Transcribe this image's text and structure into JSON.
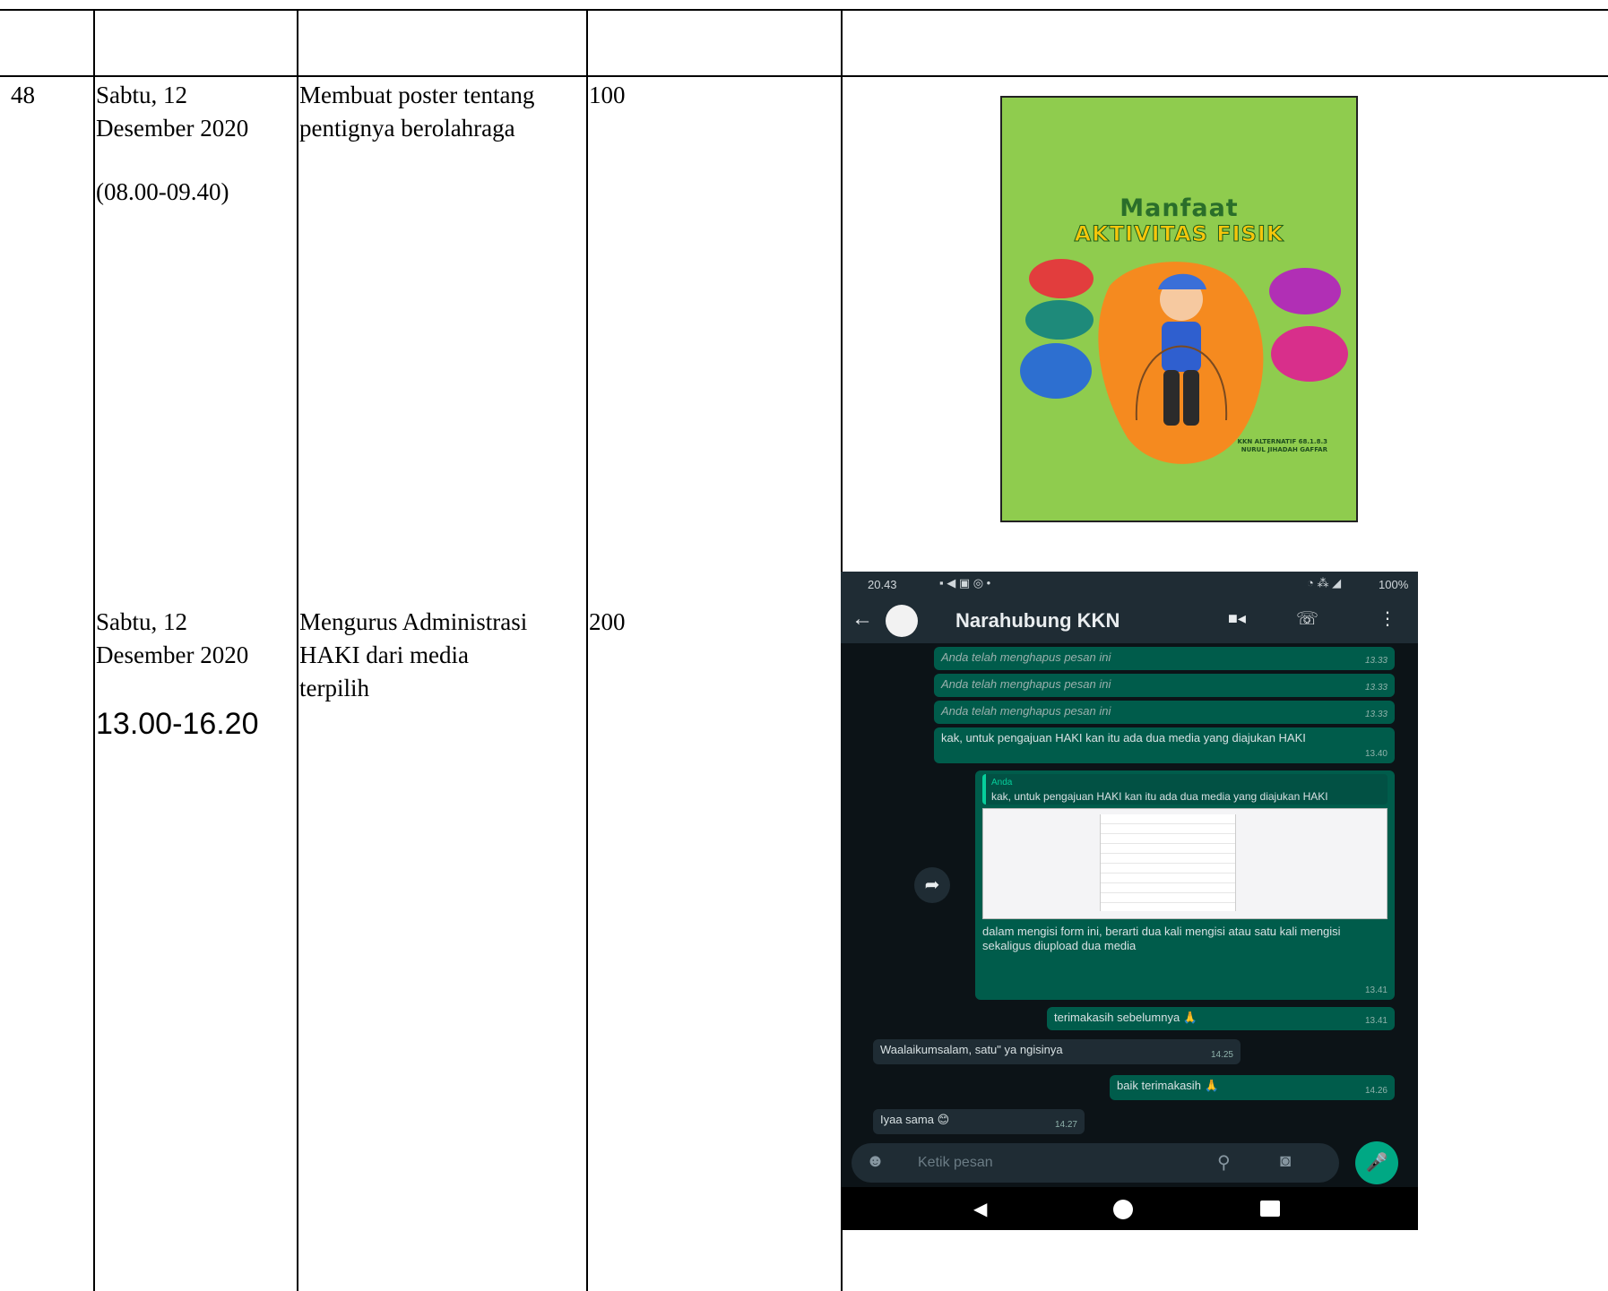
{
  "table": {
    "row_no": "48",
    "entries": [
      {
        "date_line1": "Sabtu, 12",
        "date_line2": "Desember 2020",
        "time": "(08.00-09.40)",
        "activity_line1": "Membuat poster tentang",
        "activity_line2": "pentignya berolahraga",
        "value": "100"
      },
      {
        "date_line1": "Sabtu, 12",
        "date_line2": "Desember 2020",
        "time": "13.00-16.20",
        "activity_line1": "Mengurus Administrasi",
        "activity_line2": "HAKI dari media",
        "activity_line3": "terpilih",
        "value": "200"
      }
    ]
  },
  "poster": {
    "title_line1": "Manfaat",
    "title_line2": "AKTIVITAS FISIK",
    "credit_line1": "KKN ALTERNATIF 68.1.8.3",
    "credit_line2": "NURUL JIHADAH GAFFAR",
    "background": "#8fcc4e"
  },
  "chat": {
    "status_time": "20.43",
    "battery": "100%",
    "contact_name": "Narahubung KKN",
    "messages": [
      {
        "text": "Anda telah menghapus pesan ini",
        "time": "13.33"
      },
      {
        "text": "Anda telah menghapus pesan ini",
        "time": "13.33"
      },
      {
        "text": "Anda telah menghapus pesan ini",
        "time": "13.33"
      },
      {
        "text": "kak, untuk pengajuan HAKI kan itu ada dua media yang diajukan HAKI",
        "time": "13.40"
      },
      {
        "quote_author": "Anda",
        "quote_text": "kak, untuk pengajuan HAKI kan itu ada dua media yang diajukan HAKI",
        "text": "dalam mengisi form ini, berarti dua kali mengisi atau satu kali mengisi sekaligus diupload dua media",
        "time": "13.41"
      },
      {
        "text": "terimakasih sebelumnya 🙏",
        "time": "13.41"
      },
      {
        "text": "Waalaikumsalam, satu\" ya ngisinya",
        "time": "14.25"
      },
      {
        "text": "baik terimakasih 🙏",
        "time": "14.26"
      },
      {
        "text": "Iyaa sama 😊",
        "time": "14.27"
      }
    ],
    "input_placeholder": "Ketik pesan"
  }
}
